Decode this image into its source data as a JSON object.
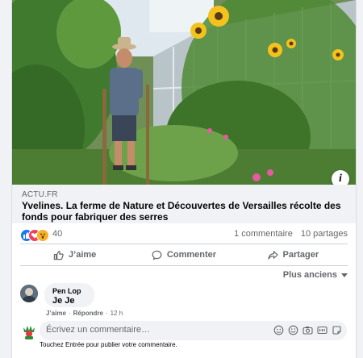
{
  "post": {
    "link_domain": "ACTU.FR",
    "headline": "Yvelines. La ferme de Nature et Découvertes de Versailles récolte des fonds pour fabriquer des serres",
    "info_badge": "i"
  },
  "stats": {
    "reaction_icons": [
      "like-icon",
      "love-icon",
      "wow-icon"
    ],
    "reaction_count": "40",
    "comments": "1 commentaire",
    "shares": "10 partages"
  },
  "actions": {
    "like": "J’aime",
    "comment": "Commenter",
    "share": "Partager"
  },
  "comments": {
    "sort_label": "Plus anciens",
    "items": [
      {
        "author": "Pen Lop",
        "text": "Je Je",
        "like": "J’aime",
        "reply": "Répondre",
        "time": "12 h"
      }
    ]
  },
  "composer": {
    "placeholder": "Écrivez un commentaire…",
    "hint": "Touchez Entrée pour publier votre commentaire.",
    "tool_icons": [
      "avatar-sticker-icon",
      "emoji-icon",
      "camera-icon",
      "gif-icon",
      "sticker-icon"
    ]
  },
  "colors": {
    "brand": "#1877f2",
    "love": "#f33e58",
    "wow": "#f7b125",
    "secondary_text": "#65676b",
    "surface": "#f0f2f5"
  }
}
